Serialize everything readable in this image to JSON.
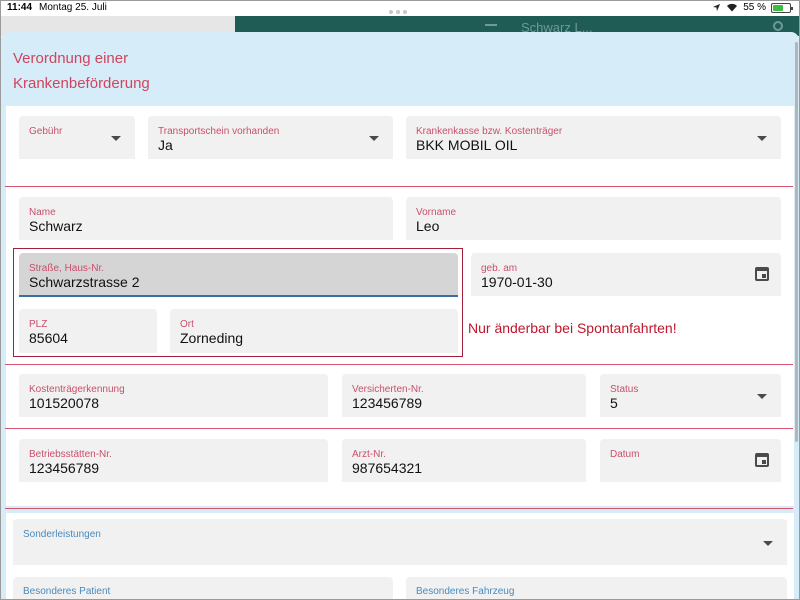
{
  "status_bar": {
    "time": "11:44",
    "date": "Montag 25. Juli",
    "battery": "55 %"
  },
  "background_app": {
    "title": "Schwarz L..."
  },
  "title_line1": "Verordnung einer",
  "title_line2": "Krankenbeförderung",
  "fields": {
    "gebuehr": {
      "label": "Gebühr",
      "value": ""
    },
    "transportschein": {
      "label": "Transportschein vorhanden",
      "value": "Ja"
    },
    "krankenkasse": {
      "label": "Krankenkasse bzw. Kostenträger",
      "value": "BKK MOBIL OIL"
    },
    "name": {
      "label": "Name",
      "value": "Schwarz"
    },
    "vorname": {
      "label": "Vorname",
      "value": "Leo"
    },
    "strasse": {
      "label": "Straße, Haus-Nr.",
      "value": "Schwarzstrasse 2"
    },
    "geb": {
      "label": "geb. am",
      "value": "1970-01-30"
    },
    "plz": {
      "label": "PLZ",
      "value": "85604"
    },
    "ort": {
      "label": "Ort",
      "value": "Zorneding"
    },
    "kostentraegerkennung": {
      "label": "Kostenträgerkennung",
      "value": "101520078"
    },
    "versicherten": {
      "label": "Versicherten-Nr.",
      "value": "123456789"
    },
    "status": {
      "label": "Status",
      "value": "5"
    },
    "betriebsstaetten": {
      "label": "Betriebsstätten-Nr.",
      "value": "123456789"
    },
    "arzt": {
      "label": "Arzt-Nr.",
      "value": "987654321"
    },
    "datum": {
      "label": "Datum",
      "value": ""
    },
    "sonderleistungen": {
      "label": "Sonderleistungen",
      "value": ""
    },
    "besonderes_patient": {
      "label": "Besonderes Patient",
      "value": ""
    },
    "besonderes_fahrzeug": {
      "label": "Besonderes Fahrzeug",
      "value": ""
    }
  },
  "note": "Nur änderbar bei Spontanfahrten!",
  "colors": {
    "label": "#c9506a",
    "blue_label": "#4a8bbd",
    "divider": "#d6536c",
    "note": "#c0152a",
    "sheet_bg": "#d6ecf8",
    "appbar": "#1f5c56"
  }
}
